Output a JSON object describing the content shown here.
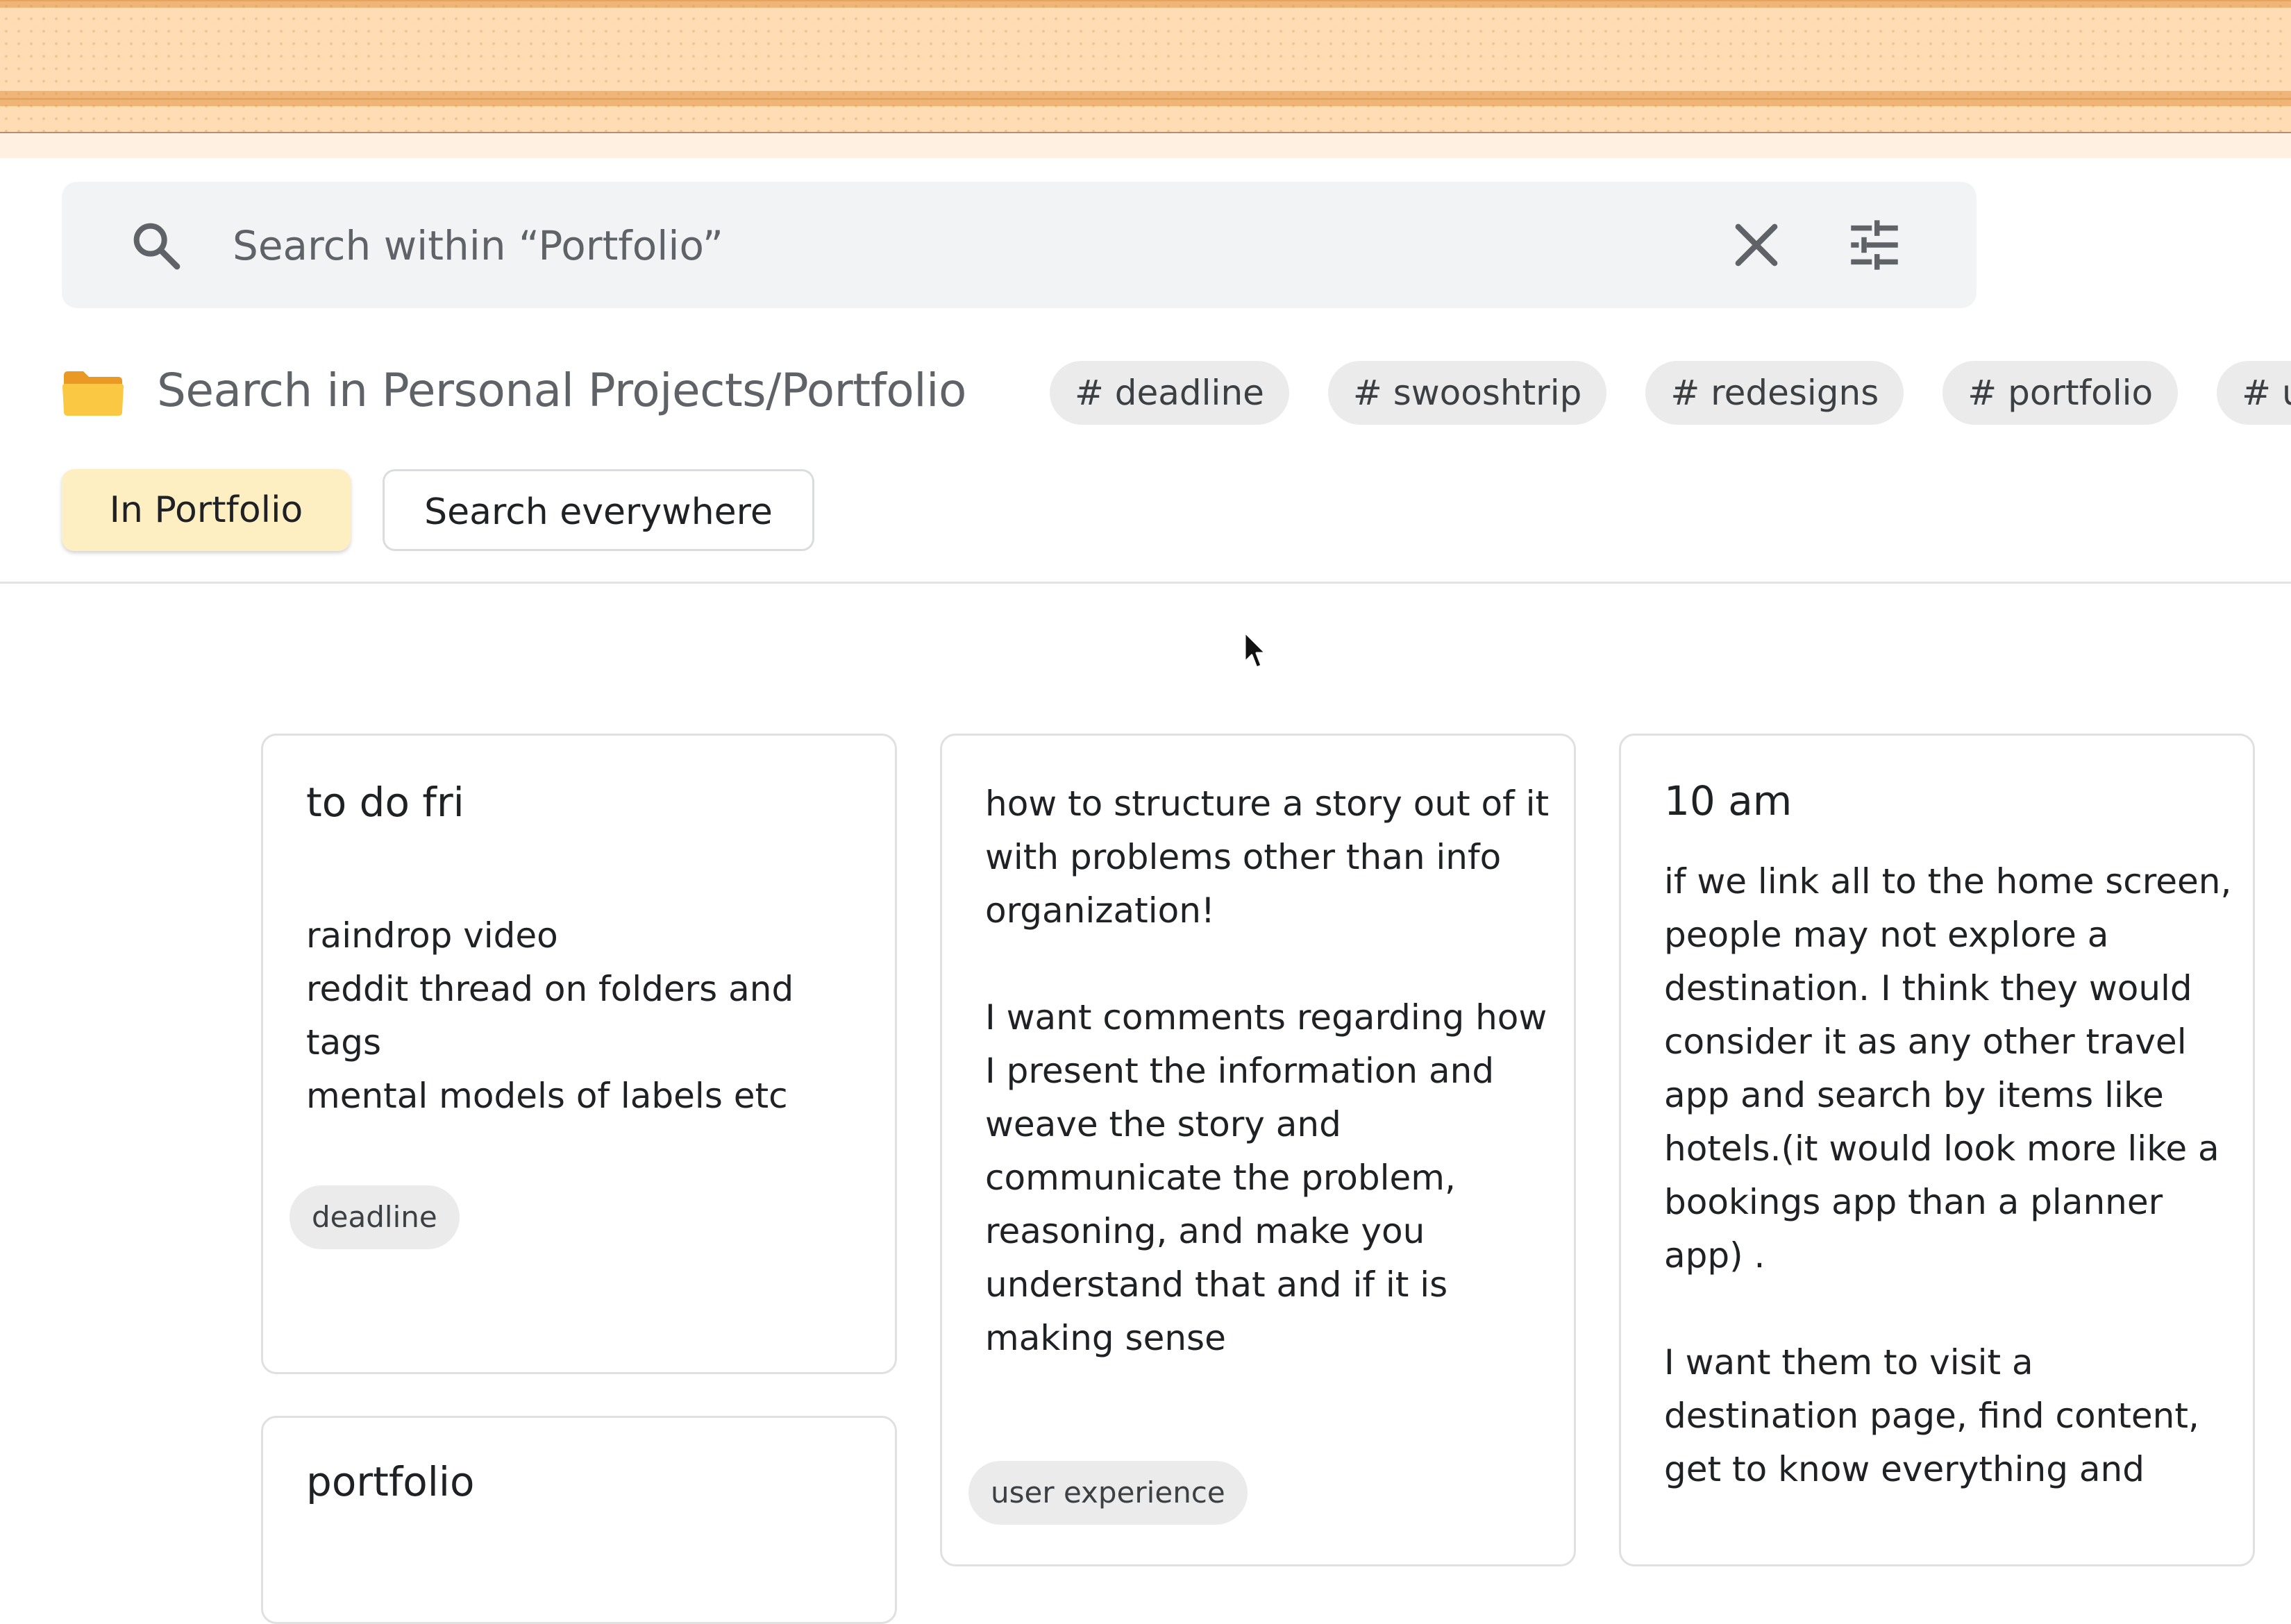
{
  "search": {
    "placeholder": "Search within “Portfolio”",
    "icons": [
      "search-icon",
      "close-icon",
      "tune-icon"
    ]
  },
  "location": {
    "title": "Search in Personal Projects/Portfolio",
    "folder_color": "#f6b93b"
  },
  "tags": [
    "# deadline",
    "# swooshtrip",
    "# redesigns",
    "# portfolio",
    "# user experience"
  ],
  "scope": {
    "active_label": "In Portfolio",
    "other_label": "Search everywhere",
    "active_color": "#feefc3"
  },
  "notes": [
    {
      "title": "to do fri",
      "body": "raindrop video\nreddit thread on folders and tags\nmental models of labels etc",
      "label": "deadline"
    },
    {
      "title": "portfolio"
    },
    {
      "body": "how to structure a story out of it with problems other than info organization!\n\nI want comments regarding how I present the information and weave the story and communicate the problem, reasoning, and make you understand that and if it is making sense",
      "label": "user experience"
    },
    {
      "title": "10 am",
      "body": "if we link all to the home screen, people may not explore a destination. I think they would consider it as any other travel app and search by items like hotels.(it would look more like a bookings app than a planner app) .\n\nI want them to visit a destination page, find content, get to know everything and"
    }
  ]
}
